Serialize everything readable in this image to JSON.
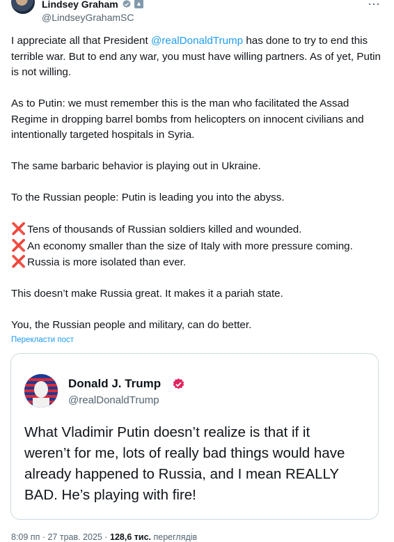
{
  "author": {
    "name": "Lindsey Graham",
    "handle": "@LindseyGrahamSC",
    "verified_color": "#829aab"
  },
  "tweet": {
    "text_p1_before": "I appreciate all that President ",
    "mention": "@realDonaldTrump",
    "text_p1_after": " has done to try to end this terrible war. But to end any war, you must have willing partners. As of yet, Putin is not willing.",
    "p2": "As to Putin: we must remember this is the man who facilitated the Assad Regime in dropping barrel bombs from helicopters on innocent civilians and intentionally targeted hospitals in Syria.",
    "p3": "The same barbaric behavior is playing out in Ukraine.",
    "p4": "To the Russian people: Putin is leading you into the abyss.",
    "bullets": [
      "Tens of thousands of Russian soldiers killed and wounded.",
      "An economy smaller than the size of Italy with more pressure coming.",
      "Russia is more isolated than ever."
    ],
    "bullet_icon": "cross-mark-icon",
    "p5": "This doesn’t make Russia great. It makes it a pariah state.",
    "p6": "You, the Russian people and military, can do better."
  },
  "translate_label": "Перекласти пост",
  "quote": {
    "name": "Donald J. Trump",
    "handle": "@realDonaldTrump",
    "badge_color": "#e0245e",
    "text": "What Vladimir Putin doesn’t realize is that if it weren’t for me, lots of really bad things would have already happened to Russia, and I mean REALLY BAD. He’s playing with fire!"
  },
  "meta": {
    "time": "8:09 пп",
    "date": "27 трав. 2025",
    "views": "128,6 тис.",
    "views_label": "переглядів",
    "separator": "·"
  }
}
